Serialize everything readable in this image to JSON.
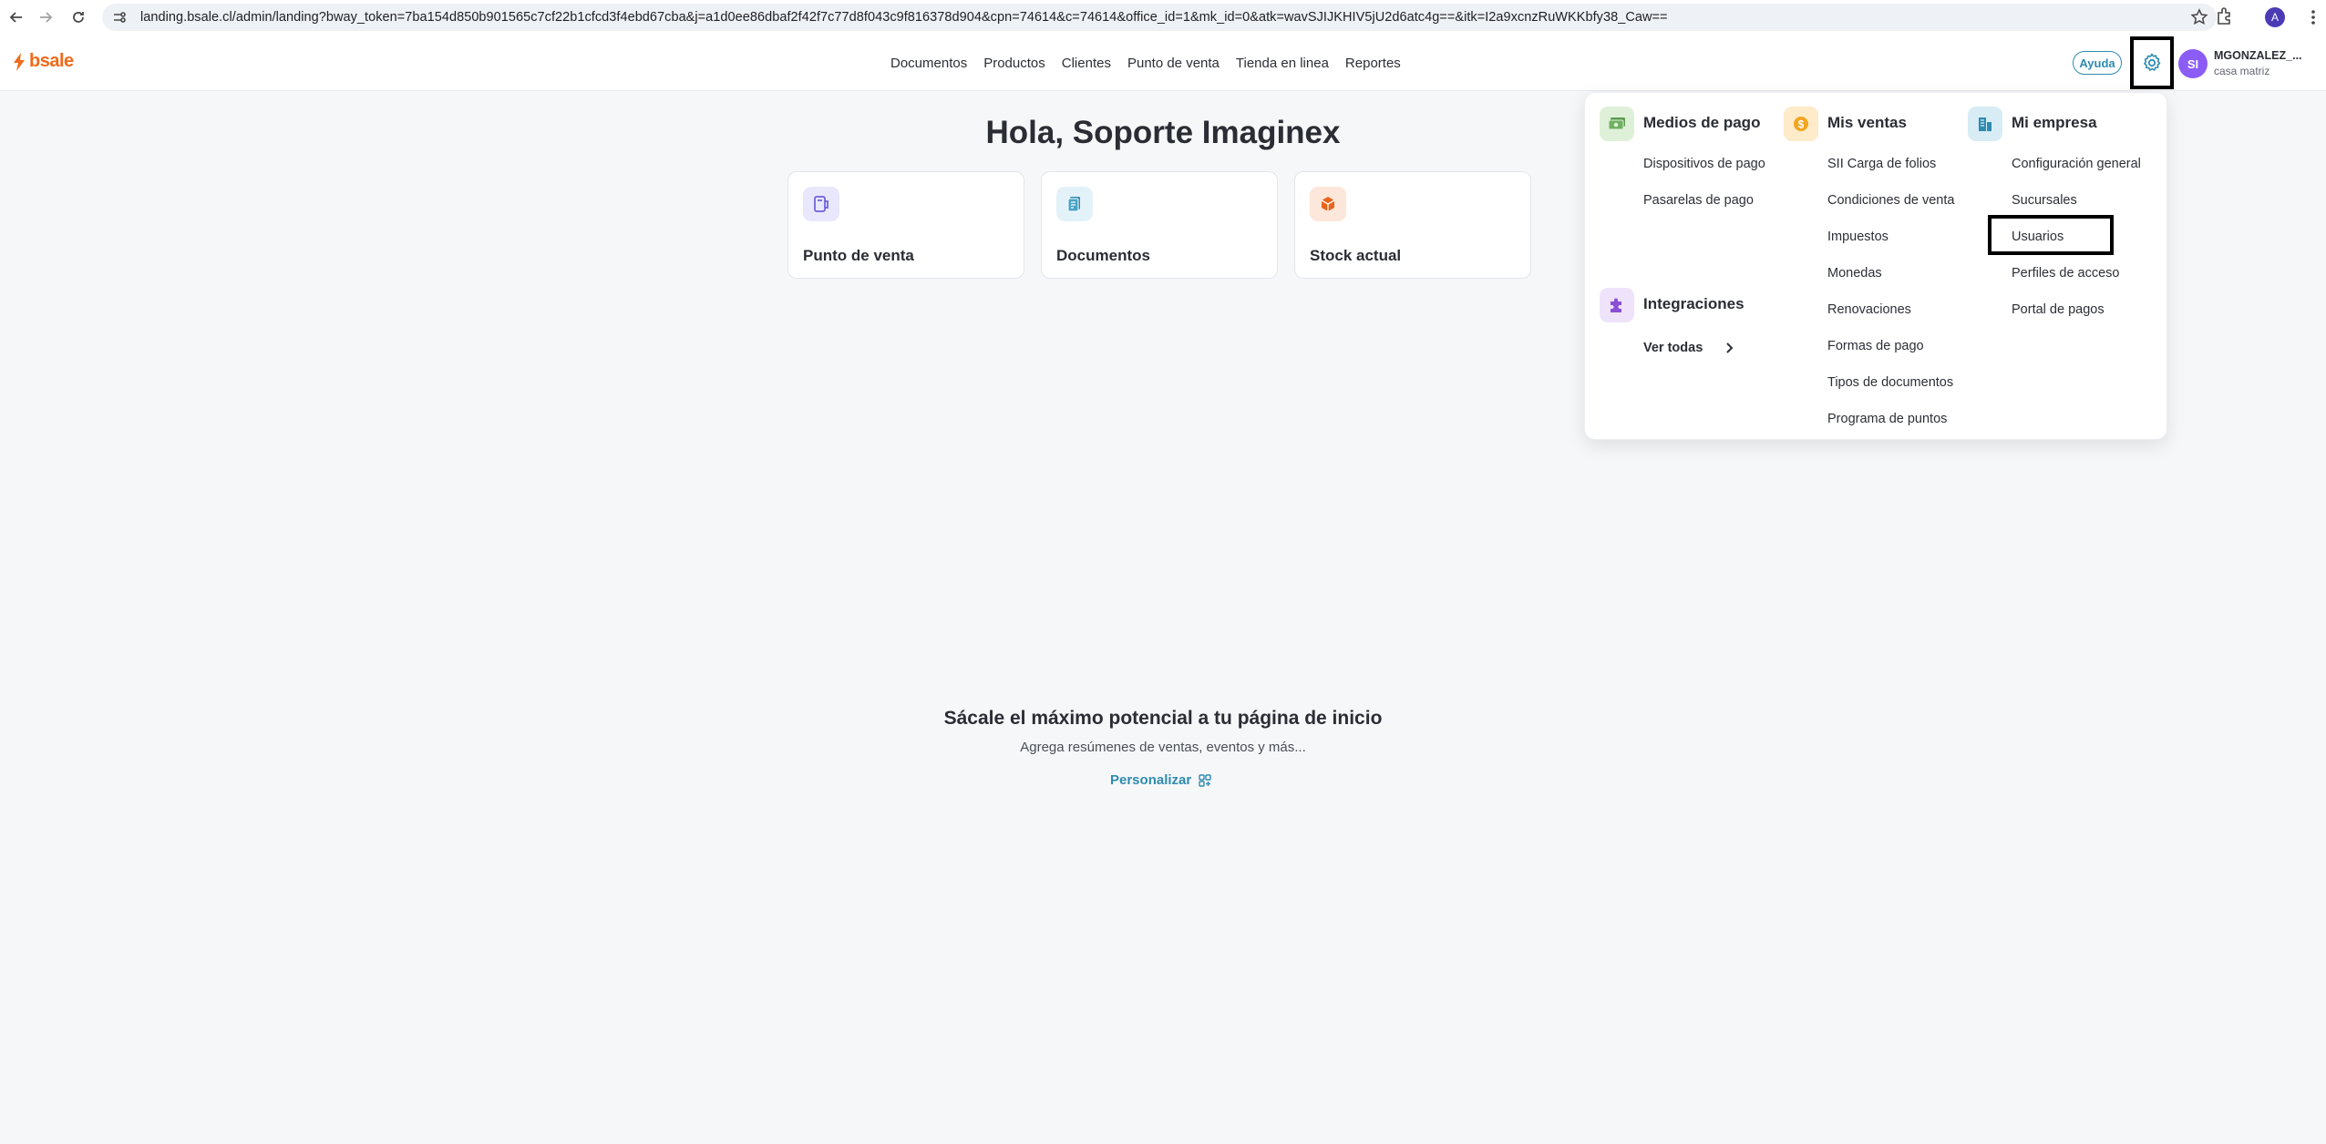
{
  "browser": {
    "url": "landing.bsale.cl/admin/landing?bway_token=7ba154d850b901565c7cf22b1cfcd3f4ebd67cba&j=a1d0ee86dbaf2f42f7c77d8f043c9f816378d904&cpn=74614&c=74614&office_id=1&mk_id=0&atk=wavSJIJKHIV5jU2d6atc4g==&itk=I2a9xcnzRuWKKbfy38_Caw==",
    "profile_initial": "A"
  },
  "header": {
    "logo_text": "bsale",
    "nav": [
      "Documentos",
      "Productos",
      "Clientes",
      "Punto de venta",
      "Tienda en linea",
      "Reportes"
    ],
    "help_label": "Ayuda",
    "avatar_initials": "SI",
    "user_name": "MGONZALEZ_...",
    "user_office": "casa matriz"
  },
  "main": {
    "greeting": "Hola, Soporte Imaginex",
    "cards": [
      {
        "label": "Punto de venta",
        "icon": "pos-icon",
        "color": "#6b5fd6",
        "bg": "#e9e7fb"
      },
      {
        "label": "Documentos",
        "icon": "document-icon",
        "color": "#2f8bb0",
        "bg": "#e3f2f8"
      },
      {
        "label": "Stock actual",
        "icon": "box-icon",
        "color": "#e8641c",
        "bg": "#fde6da"
      }
    ],
    "promo_title": "Sácale el máximo potencial a tu página de inicio",
    "promo_subtitle": "Agrega resúmenes de ventas, eventos y más...",
    "personalize_label": "Personalizar"
  },
  "dropdown": {
    "medios_de_pago": {
      "title": "Medios de pago",
      "items": [
        "Dispositivos de pago",
        "Pasarelas de pago"
      ]
    },
    "integraciones": {
      "title": "Integraciones",
      "see_all": "Ver todas"
    },
    "mis_ventas": {
      "title": "Mis ventas",
      "items": [
        "SII Carga de folios",
        "Condiciones de venta",
        "Impuestos",
        "Monedas",
        "Renovaciones",
        "Formas de pago",
        "Tipos de documentos",
        "Programa de puntos"
      ]
    },
    "mi_empresa": {
      "title": "Mi empresa",
      "items": [
        "Configuración general",
        "Sucursales",
        "Usuarios",
        "Perfiles de acceso",
        "Portal de pagos"
      ]
    }
  },
  "colors": {
    "brand": "#ef6a1a",
    "accent": "#2f8bb0",
    "avatar": "#8b5cf6"
  }
}
